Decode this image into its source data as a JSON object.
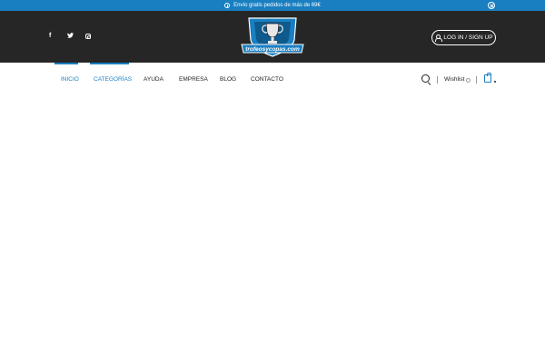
{
  "promo": {
    "text": "Envío gratis pedidos de más de 69€",
    "icon": "info-icon",
    "close_icon": "close-icon",
    "background": "#1a7fc1"
  },
  "header": {
    "background": "#262626",
    "social": [
      {
        "name": "facebook-icon",
        "glyph": "f"
      },
      {
        "name": "twitter-icon",
        "glyph": "🐦"
      },
      {
        "name": "instagram-icon",
        "glyph": ""
      }
    ],
    "logo_text": "trofeosycopas.com",
    "login_label": "LOG IN / SIGN UP"
  },
  "nav": {
    "items": [
      {
        "label": "INICIO",
        "active": true
      },
      {
        "label": "CATEGORÍAS",
        "active": true
      },
      {
        "label": "AYUDA",
        "active": false
      },
      {
        "label": "EMPRESA",
        "active": false
      },
      {
        "label": "BLOG",
        "active": false
      },
      {
        "label": "CONTACTO",
        "active": false
      }
    ],
    "wishlist_label": "Wishlist",
    "accent": "#1a7fc1"
  }
}
